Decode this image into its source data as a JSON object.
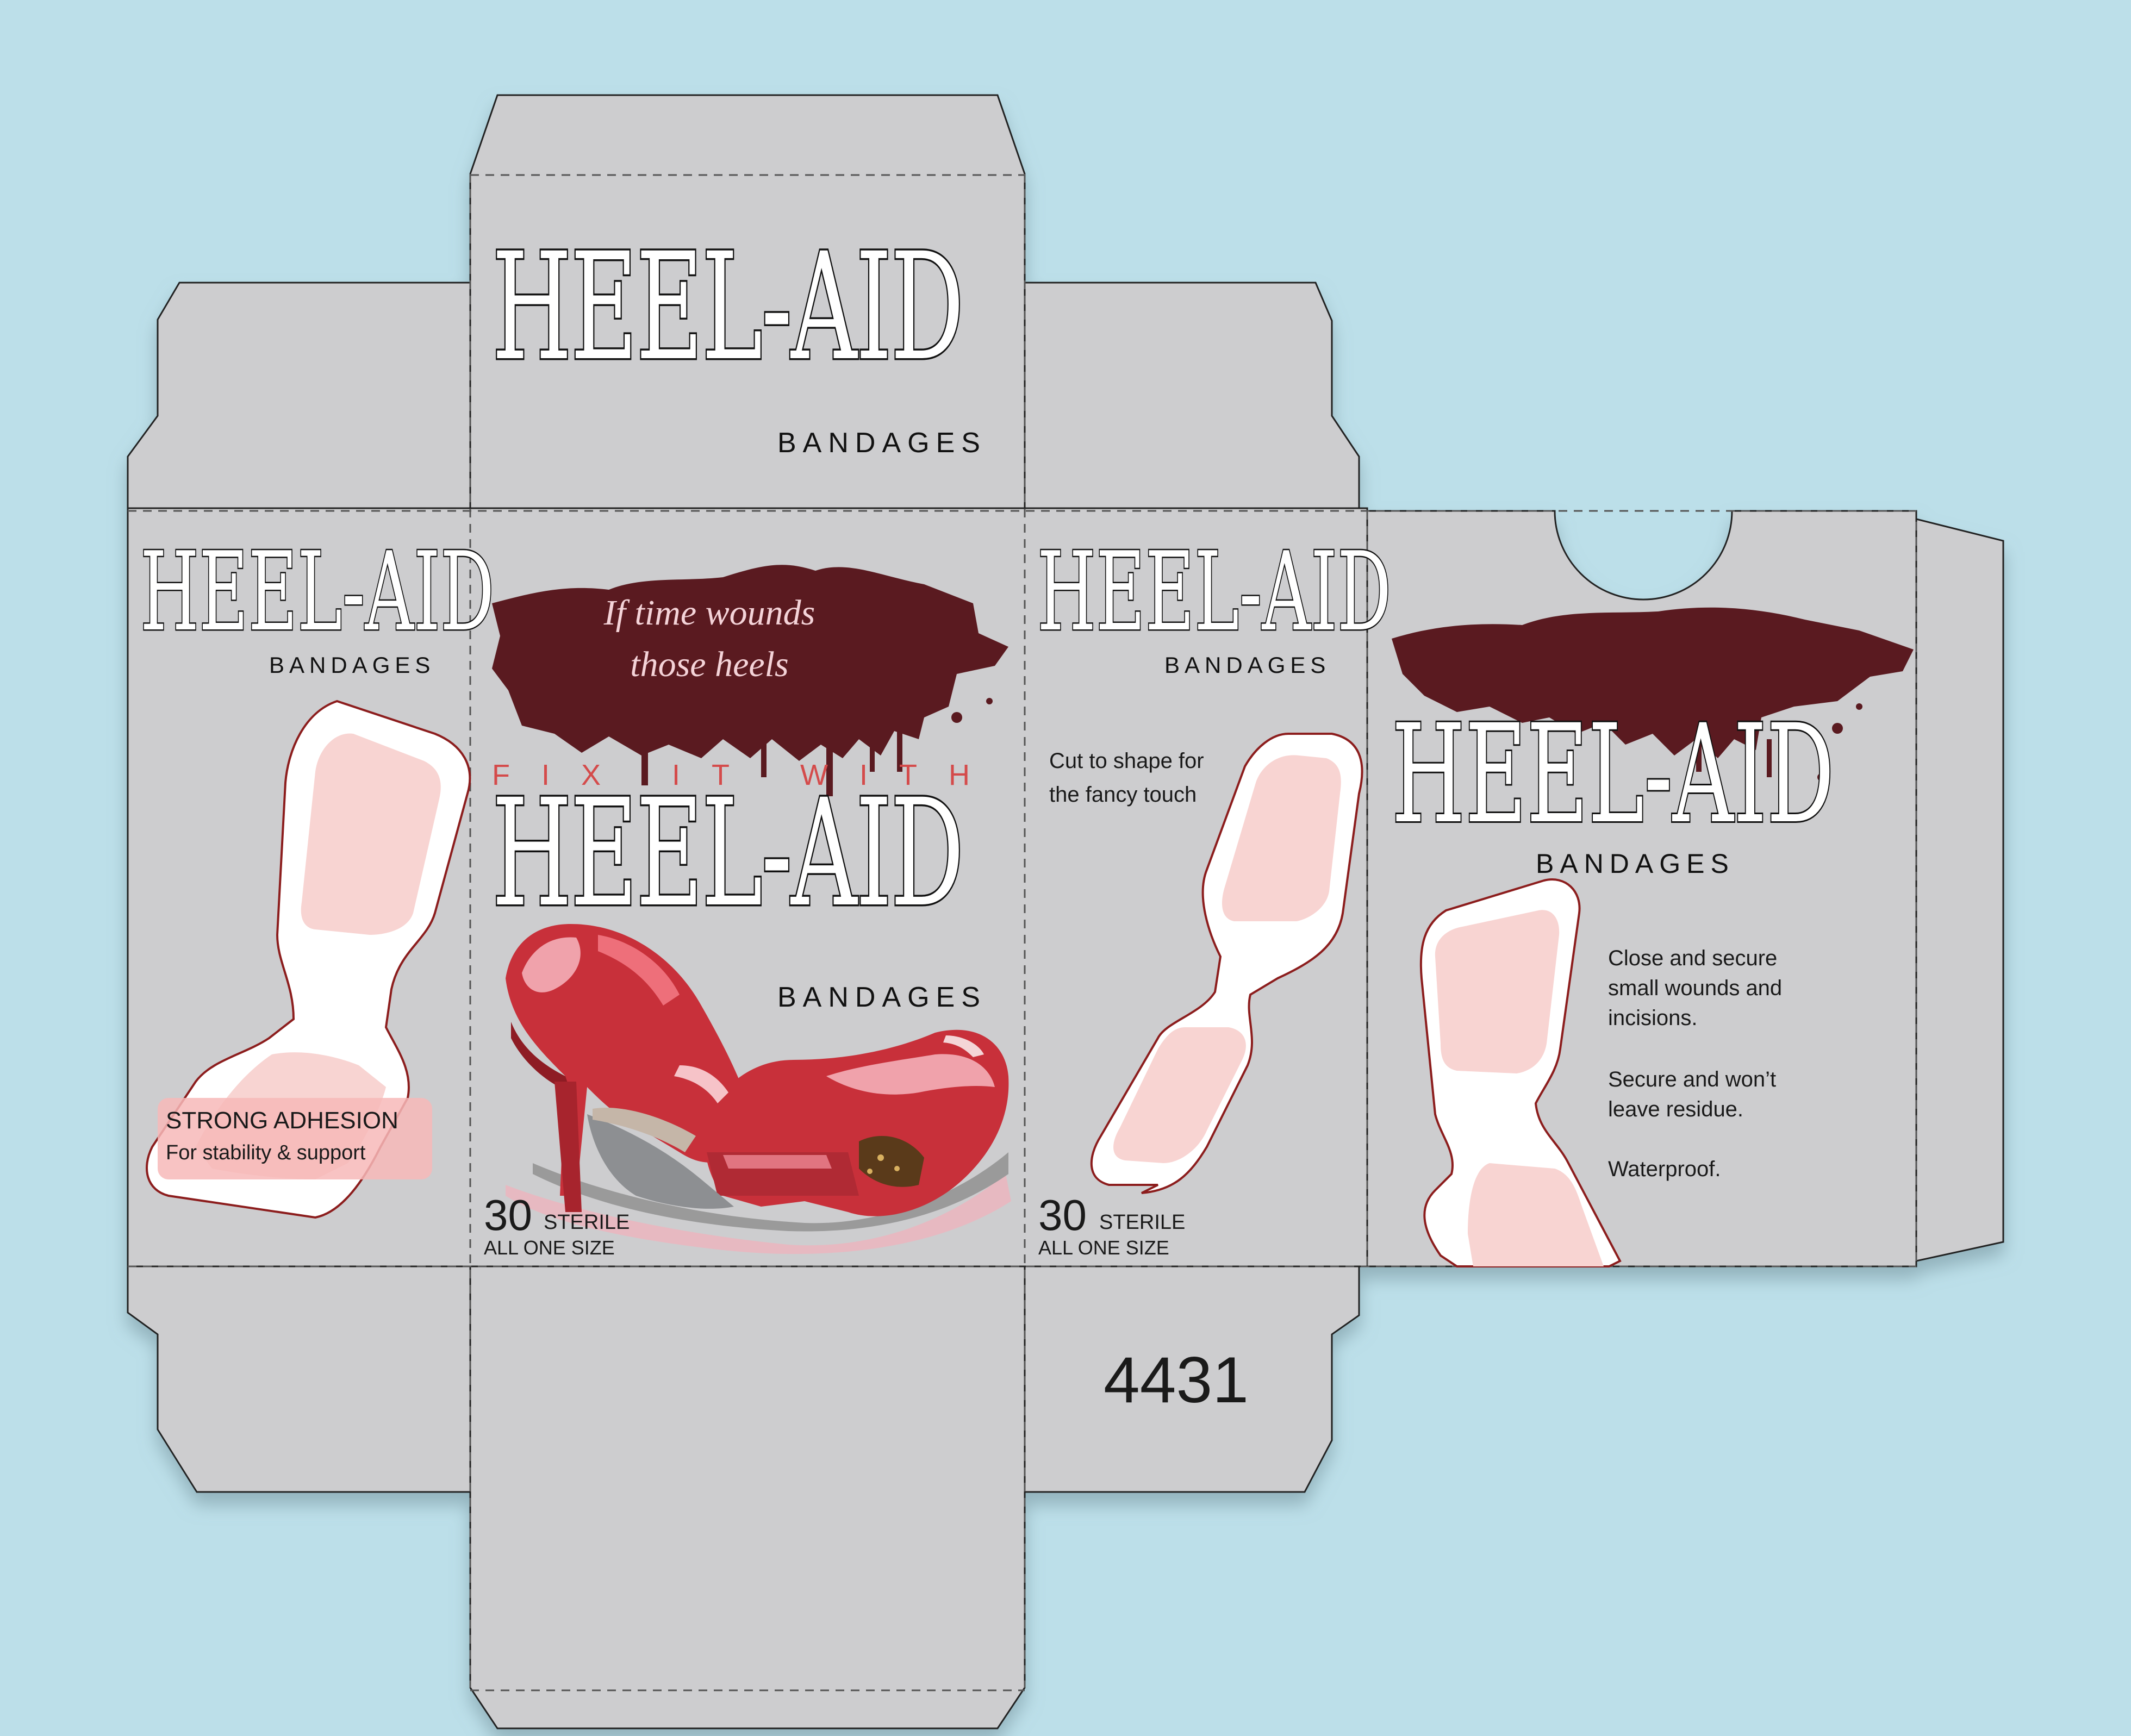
{
  "colors": {
    "background": "#bcdfe9",
    "carton": "#cdcdcf",
    "blood": "#5a1a20",
    "bandage_pad": "#f8d4d2",
    "bandage_outline": "#8c1d1d",
    "fix_text": "#d44b4b",
    "shoe_red": "#c8303a"
  },
  "top_flap": {
    "brand": "HEEL-AID",
    "sub": "BANDAGES"
  },
  "left_side": {
    "brand": "HEEL-AID",
    "sub": "BANDAGES",
    "badge_title": "STRONG ADHESION",
    "badge_sub": "For stability & support"
  },
  "front": {
    "tagline_line1": "If time wounds",
    "tagline_line2": "those heels",
    "fix_it_with": "FIX IT WITH",
    "brand": "HEEL-AID",
    "sub": "BANDAGES",
    "count": "30",
    "count_label": "STERILE",
    "size": "ALL ONE SIZE"
  },
  "right_side": {
    "brand": "HEEL-AID",
    "sub": "BANDAGES",
    "note_line1": "Cut to shape for",
    "note_line2": "the fancy touch",
    "count": "30",
    "count_label": "STERILE",
    "size": "ALL ONE SIZE"
  },
  "bottom_flap": {
    "code": "4431"
  },
  "back": {
    "brand": "HEEL-AID",
    "sub": "BANDAGES",
    "copy_1_l1": "Close and secure",
    "copy_1_l2": "small wounds and",
    "copy_1_l3": "incisions.",
    "copy_2_l1": "Secure and won’t",
    "copy_2_l2": "leave residue.",
    "copy_3": "Waterproof."
  }
}
